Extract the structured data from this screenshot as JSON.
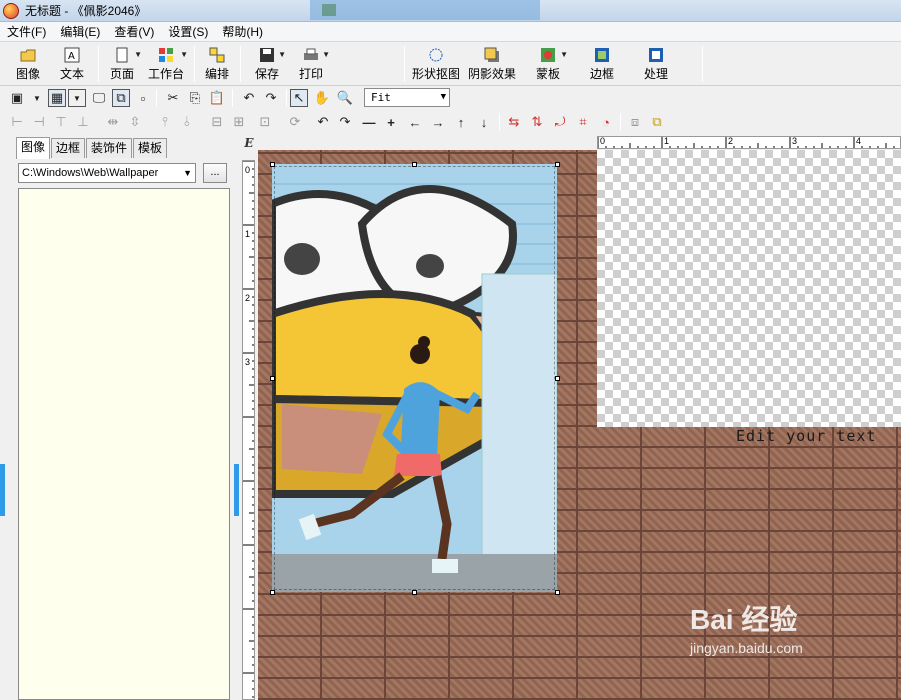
{
  "window": {
    "title": "无标题 - 《佩影2046》"
  },
  "menu": [
    "文件(F)",
    "编辑(E)",
    "查看(V)",
    "设置(S)",
    "帮助(H)"
  ],
  "big_toolbar": [
    {
      "label": "图像",
      "icon": "image-icon"
    },
    {
      "label": "文本",
      "icon": "text-icon"
    },
    {
      "label": "页面",
      "icon": "page-icon"
    },
    {
      "label": "工作台",
      "icon": "workbench-icon"
    },
    {
      "label": "编排",
      "icon": "arrange-icon"
    },
    {
      "label": "保存",
      "icon": "save-icon"
    },
    {
      "label": "打印",
      "icon": "print-icon"
    },
    {
      "label": "形状抠图",
      "icon": "shape-cutout-icon"
    },
    {
      "label": "阴影效果",
      "icon": "shadow-effect-icon"
    },
    {
      "label": "蒙板",
      "icon": "mask-icon"
    },
    {
      "label": "边框",
      "icon": "border-icon"
    },
    {
      "label": "处理",
      "icon": "process-icon"
    }
  ],
  "zoom": {
    "value": "Fit"
  },
  "left_panel": {
    "tabs": [
      "图像",
      "边框",
      "装饰件",
      "模板"
    ],
    "active_tab": "图像",
    "path": "C:\\Windows\\Web\\Wallpaper",
    "browse_label": "..."
  },
  "ruler": {
    "corner": "E",
    "h_labels": [
      "0",
      "1",
      "2",
      "3",
      "4"
    ],
    "v_labels": [
      "0",
      "1",
      "2",
      "3"
    ]
  },
  "canvas": {
    "overlay_text": "Edit your text",
    "colors": {
      "brick": "#9a6a55",
      "mortar": "#6a4538",
      "wall_blue": "#a9d3ea",
      "beak_yellow": "#f4c534"
    }
  },
  "watermark": {
    "brand": "Bai 经验",
    "url": "jingyan.baidu.com"
  }
}
